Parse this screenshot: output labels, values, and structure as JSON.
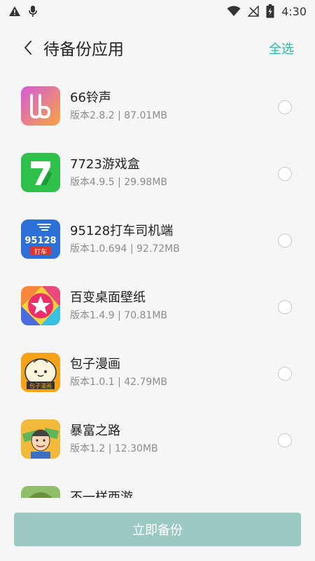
{
  "status_bar": {
    "time": "4:30",
    "icons": [
      "warning-icon",
      "mic-icon",
      "wifi-icon",
      "no-signal-icon",
      "battery-charging-icon"
    ]
  },
  "header": {
    "title": "待备份应用",
    "select_all": "全选",
    "back_icon": "back-chevron-icon"
  },
  "apps": [
    {
      "name": "66铃声",
      "meta": "版本2.8.2 | 87.01MB"
    },
    {
      "name": "7723游戏盒",
      "meta": "版本4.9.5 | 29.98MB"
    },
    {
      "name": "95128打车司机端",
      "meta": "版本1.0.694 | 92.72MB",
      "icon_text_top": "95128",
      "icon_text_bottom": "打车"
    },
    {
      "name": "百变桌面壁纸",
      "meta": "版本1.4.9 | 70.81MB"
    },
    {
      "name": "包子漫画",
      "meta": "版本1.0.1 | 42.79MB",
      "icon_text": "包子漫画"
    },
    {
      "name": "暴富之路",
      "meta": "版本1.2 | 12.30MB"
    },
    {
      "name": "不一样西游",
      "meta": ""
    }
  ],
  "footer": {
    "backup_label": "立即备份"
  },
  "colors": {
    "accent": "#26b8a7",
    "button_disabled": "#9cc9c1",
    "background": "#f6f6f6"
  }
}
